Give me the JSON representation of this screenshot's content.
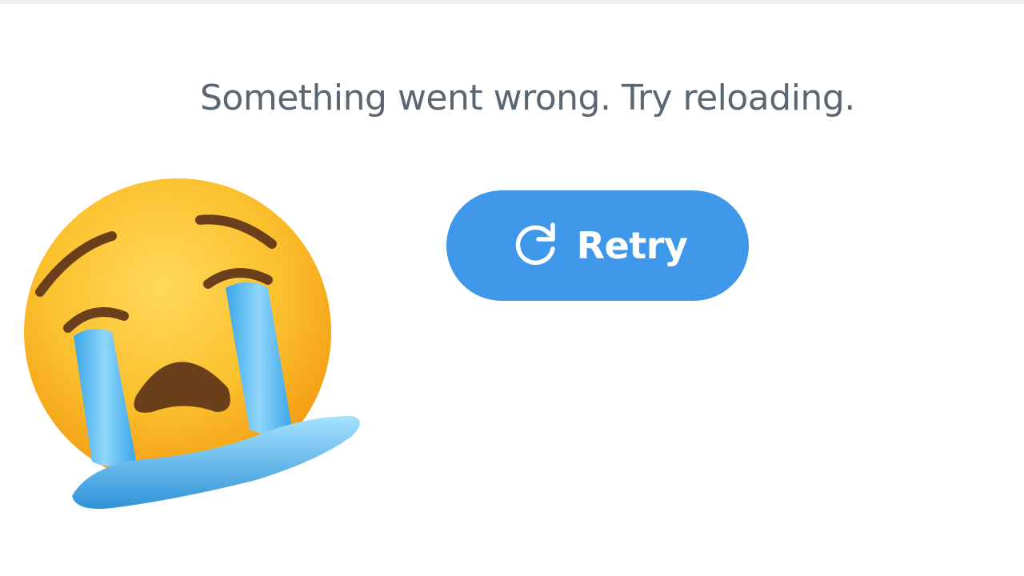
{
  "error": {
    "message": "Something went wrong. Try reloading."
  },
  "retry_button": {
    "label": "Retry",
    "icon": "refresh-icon",
    "color": "#3e97e8"
  },
  "decoration": {
    "icon": "loudly-crying-face-emoji"
  },
  "colors": {
    "background": "#ffffff",
    "message_text": "#5b6670",
    "button_text": "#ffffff"
  }
}
